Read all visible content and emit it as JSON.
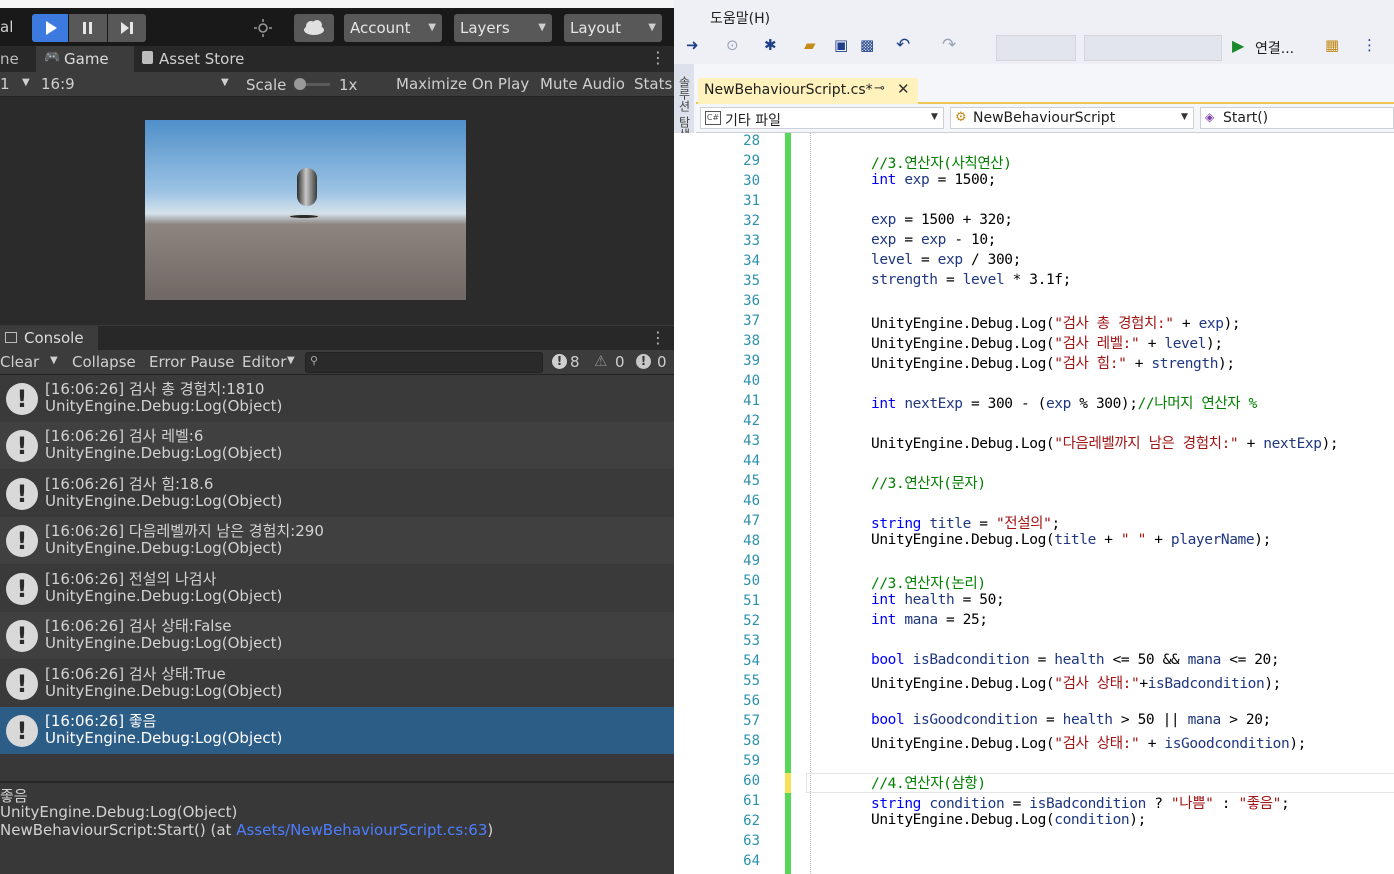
{
  "unity": {
    "toolbar": {
      "left_cut": "al",
      "account": "Account",
      "layers": "Layers",
      "layout": "Layout"
    },
    "view_tabs": {
      "scene_cut": "ne",
      "game": "Game",
      "asset_store": "Asset Store"
    },
    "game_bar": {
      "display_cut": "1",
      "aspect": "16:9",
      "scale_label": "Scale",
      "scale_value": "1x",
      "maximize": "Maximize On Play",
      "mute": "Mute Audio",
      "stats": "Stats"
    },
    "console": {
      "tab": "Console",
      "clear": "Clear",
      "collapse": "Collapse",
      "error_pause": "Error Pause",
      "editor": "Editor",
      "count_log": "8",
      "count_warn": "0",
      "count_error": "0",
      "entries": [
        {
          "line1": "[16:06:26] 검사 총 경험치:1810",
          "line2": "UnityEngine.Debug:Log(Object)"
        },
        {
          "line1": "[16:06:26] 검사 레벨:6",
          "line2": "UnityEngine.Debug:Log(Object)"
        },
        {
          "line1": "[16:06:26] 검사 힘:18.6",
          "line2": "UnityEngine.Debug:Log(Object)"
        },
        {
          "line1": "[16:06:26] 다음레벨까지 남은 경험치:290",
          "line2": "UnityEngine.Debug:Log(Object)"
        },
        {
          "line1": "[16:06:26] 전설의 나검사",
          "line2": "UnityEngine.Debug:Log(Object)"
        },
        {
          "line1": "[16:06:26] 검사 상태:False",
          "line2": "UnityEngine.Debug:Log(Object)"
        },
        {
          "line1": "[16:06:26] 검사 상태:True",
          "line2": "UnityEngine.Debug:Log(Object)"
        },
        {
          "line1": "[16:06:26] 좋음",
          "line2": "UnityEngine.Debug:Log(Object)"
        }
      ],
      "detail": {
        "line1": "좋음",
        "line2": "UnityEngine.Debug:Log(Object)",
        "line3_prefix": "NewBehaviourScript:Start() (at ",
        "line3_link": "Assets/NewBehaviourScript.cs:63",
        "line3_suffix": ")"
      }
    }
  },
  "vs": {
    "menu_help": "도움말(H)",
    "run_label": "연결...",
    "side_tab": "솔루션 탐색기",
    "doc_tab": "NewBehaviourScript.cs*",
    "nav_project": "기타 파일",
    "nav_class": "NewBehaviourScript",
    "nav_member": "Start()",
    "line_numbers": [
      "28",
      "29",
      "30",
      "31",
      "32",
      "33",
      "34",
      "35",
      "36",
      "37",
      "38",
      "39",
      "40",
      "41",
      "42",
      "43",
      "44",
      "45",
      "46",
      "47",
      "48",
      "49",
      "50",
      "51",
      "52",
      "53",
      "54",
      "55",
      "56",
      "57",
      "58",
      "59",
      "60",
      "61",
      "62",
      "63",
      "64"
    ],
    "code": {
      "l29": "//3.연산자(사칙연산)",
      "l30": [
        "int",
        " exp",
        " = 1500;"
      ],
      "l32": [
        "exp",
        " = 1500 + 320;"
      ],
      "l33": [
        "exp",
        " = ",
        "exp",
        " - 10;"
      ],
      "l34": [
        "level",
        " = ",
        "exp",
        " / 300;"
      ],
      "l35": [
        "strength",
        " = ",
        "level",
        " * 3.1f;"
      ],
      "l37": [
        "UnityEngine.Debug.Log(",
        "\"검사 총 경험치:\"",
        " + ",
        "exp",
        ");"
      ],
      "l38": [
        "UnityEngine.Debug.Log(",
        "\"검사 레벨:\"",
        " + ",
        "level",
        ");"
      ],
      "l39": [
        "UnityEngine.Debug.Log(",
        "\"검사 힘:\"",
        " + ",
        "strength",
        ");"
      ],
      "l41": [
        "int",
        " nextExp",
        " = 300 - (",
        "exp",
        " % 300);",
        "//나머지 연산자 %"
      ],
      "l43": [
        "UnityEngine.Debug.Log(",
        "\"다음레벨까지 남은 경험치:\"",
        " + ",
        "nextExp",
        ");"
      ],
      "l45": "//3.연산자(문자)",
      "l47": [
        "string",
        " title",
        " = ",
        "\"전설의\"",
        ";"
      ],
      "l48": [
        "UnityEngine.Debug.Log(",
        "title",
        " + ",
        "\" \"",
        " + ",
        "playerName",
        ");"
      ],
      "l50": "//3.연산자(논리)",
      "l51": [
        "int",
        " health",
        " = 50;"
      ],
      "l52": [
        "int",
        " mana",
        " = 25;"
      ],
      "l54": [
        "bool",
        " isBadcondition",
        " = ",
        "health",
        " <= 50 && ",
        "mana",
        " <= 20;"
      ],
      "l55": [
        "UnityEngine.Debug.Log(",
        "\"검사 상태:\"",
        "+",
        "isBadcondition",
        ");"
      ],
      "l57": [
        "bool",
        " isGoodcondition",
        " = ",
        "health",
        " > 50 || ",
        "mana",
        " > 20;"
      ],
      "l58": [
        "UnityEngine.Debug.Log(",
        "\"검사 상태:\"",
        " + ",
        "isGoodcondition",
        ");"
      ],
      "l60": "//4.연산자(삼항)",
      "l61": [
        "string",
        " condition",
        " = ",
        "isBadcondition",
        " ? ",
        "\"나쁨\"",
        " : ",
        "\"좋음\"",
        ";"
      ],
      "l62": [
        "UnityEngine.Debug.Log(",
        "condition",
        ");"
      ]
    }
  }
}
